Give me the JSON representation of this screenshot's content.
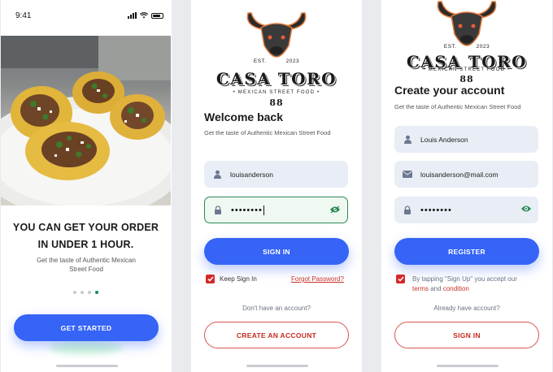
{
  "onboarding": {
    "time": "9:41",
    "headline_line1": "YOU CAN GET YOUR ORDER",
    "headline_line2": "IN UNDER 1 HOUR.",
    "subtitle_line1": "Get the taste of Authentic Mexican",
    "subtitle_line2": "Street Food",
    "page_count": 4,
    "active_page": 4,
    "cta_label": "GET STARTED"
  },
  "logo": {
    "est": "EST.",
    "year": "2023",
    "name": "CASA TORO",
    "tagline": "• MEXICAN STREET FOOD •",
    "number": "88"
  },
  "signin": {
    "title": "Welcome back",
    "subtitle": "Get the taste of Authentic Mexican Street Food",
    "username_value": "louisanderson",
    "password_value": "••••••••",
    "signin_label": "SIGN IN",
    "keep_label": "Keep Sign In",
    "keep_checked": true,
    "forgot_label": "Forgot Password?",
    "no_account_text": "Don't have an account?",
    "create_label": "CREATE AN ACCOUNT"
  },
  "signup": {
    "title": "Create your account",
    "subtitle": "Get the taste of Authentic Mexican Street Food",
    "name_value": "Louis Anderson",
    "email_value": "louisanderson@mail.com",
    "password_value": "••••••••",
    "register_label": "REGISTER",
    "terms_prefix": "By tapping \"Sign Up\" you accept our",
    "terms_link": "terms",
    "terms_and": "and",
    "condition_link": "condition",
    "have_account_text": "Already have account?",
    "signin_label": "SIGN IN"
  },
  "colors": {
    "primary_blue": "#3564f6",
    "accent_red": "#d62828",
    "focus_green": "#2b8a55",
    "field_bg": "#e9edf5"
  }
}
